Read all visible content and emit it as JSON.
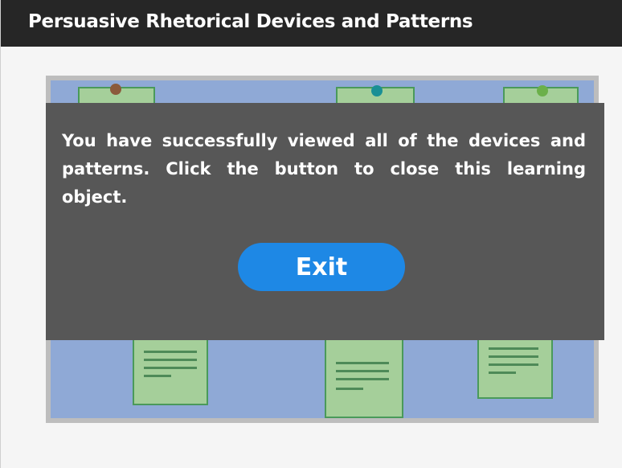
{
  "header": {
    "title": "Persuasive Rhetorical Devices and Patterns"
  },
  "dialog": {
    "message": "You have successfully viewed all of the devices and patterns.  Click the button to close this learning object.",
    "exit_label": "Exit"
  },
  "colors": {
    "title_bar": "#262626",
    "board_background": "#8fa9d6",
    "board_frame": "#bdbdbd",
    "note_fill": "#a5cf9a",
    "overlay": "#575757",
    "exit_button": "#1e88e5",
    "pin_brown": "#8b5a3c",
    "pin_teal": "#1a8f95",
    "pin_green": "#6bb04a"
  }
}
